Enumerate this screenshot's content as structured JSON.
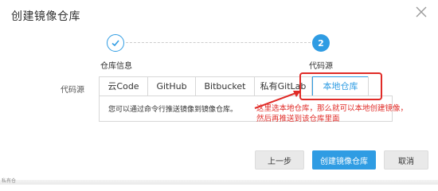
{
  "dialog": {
    "title": "创建镜像仓库"
  },
  "steps": [
    {
      "label": "仓库信息",
      "state": "completed"
    },
    {
      "number": "2",
      "label": "代码源",
      "state": "active"
    }
  ],
  "source": {
    "field_label": "代码源",
    "tabs": [
      {
        "label": "云Code"
      },
      {
        "label": "GitHub"
      },
      {
        "label": "Bitbucket"
      },
      {
        "label": "私有GitLab"
      },
      {
        "label": "本地仓库",
        "selected": true
      }
    ],
    "panel_text": "您可以通过命令行推送镜像到镜像仓库。"
  },
  "annotation": {
    "text": "这里选本地仓库，那么就可以本地创建镜像，然后再推送到该仓库里面",
    "color": "#e02b27"
  },
  "footer": {
    "prev_label": "上一步",
    "create_label": "创建镜像仓库",
    "cancel_label": "取消"
  },
  "bottom_strip": {
    "text": "私有仓"
  },
  "colors": {
    "accent": "#2f9ce3",
    "annotation": "#e02b27"
  },
  "icons": {
    "close": "close-icon",
    "check": "check-icon"
  }
}
